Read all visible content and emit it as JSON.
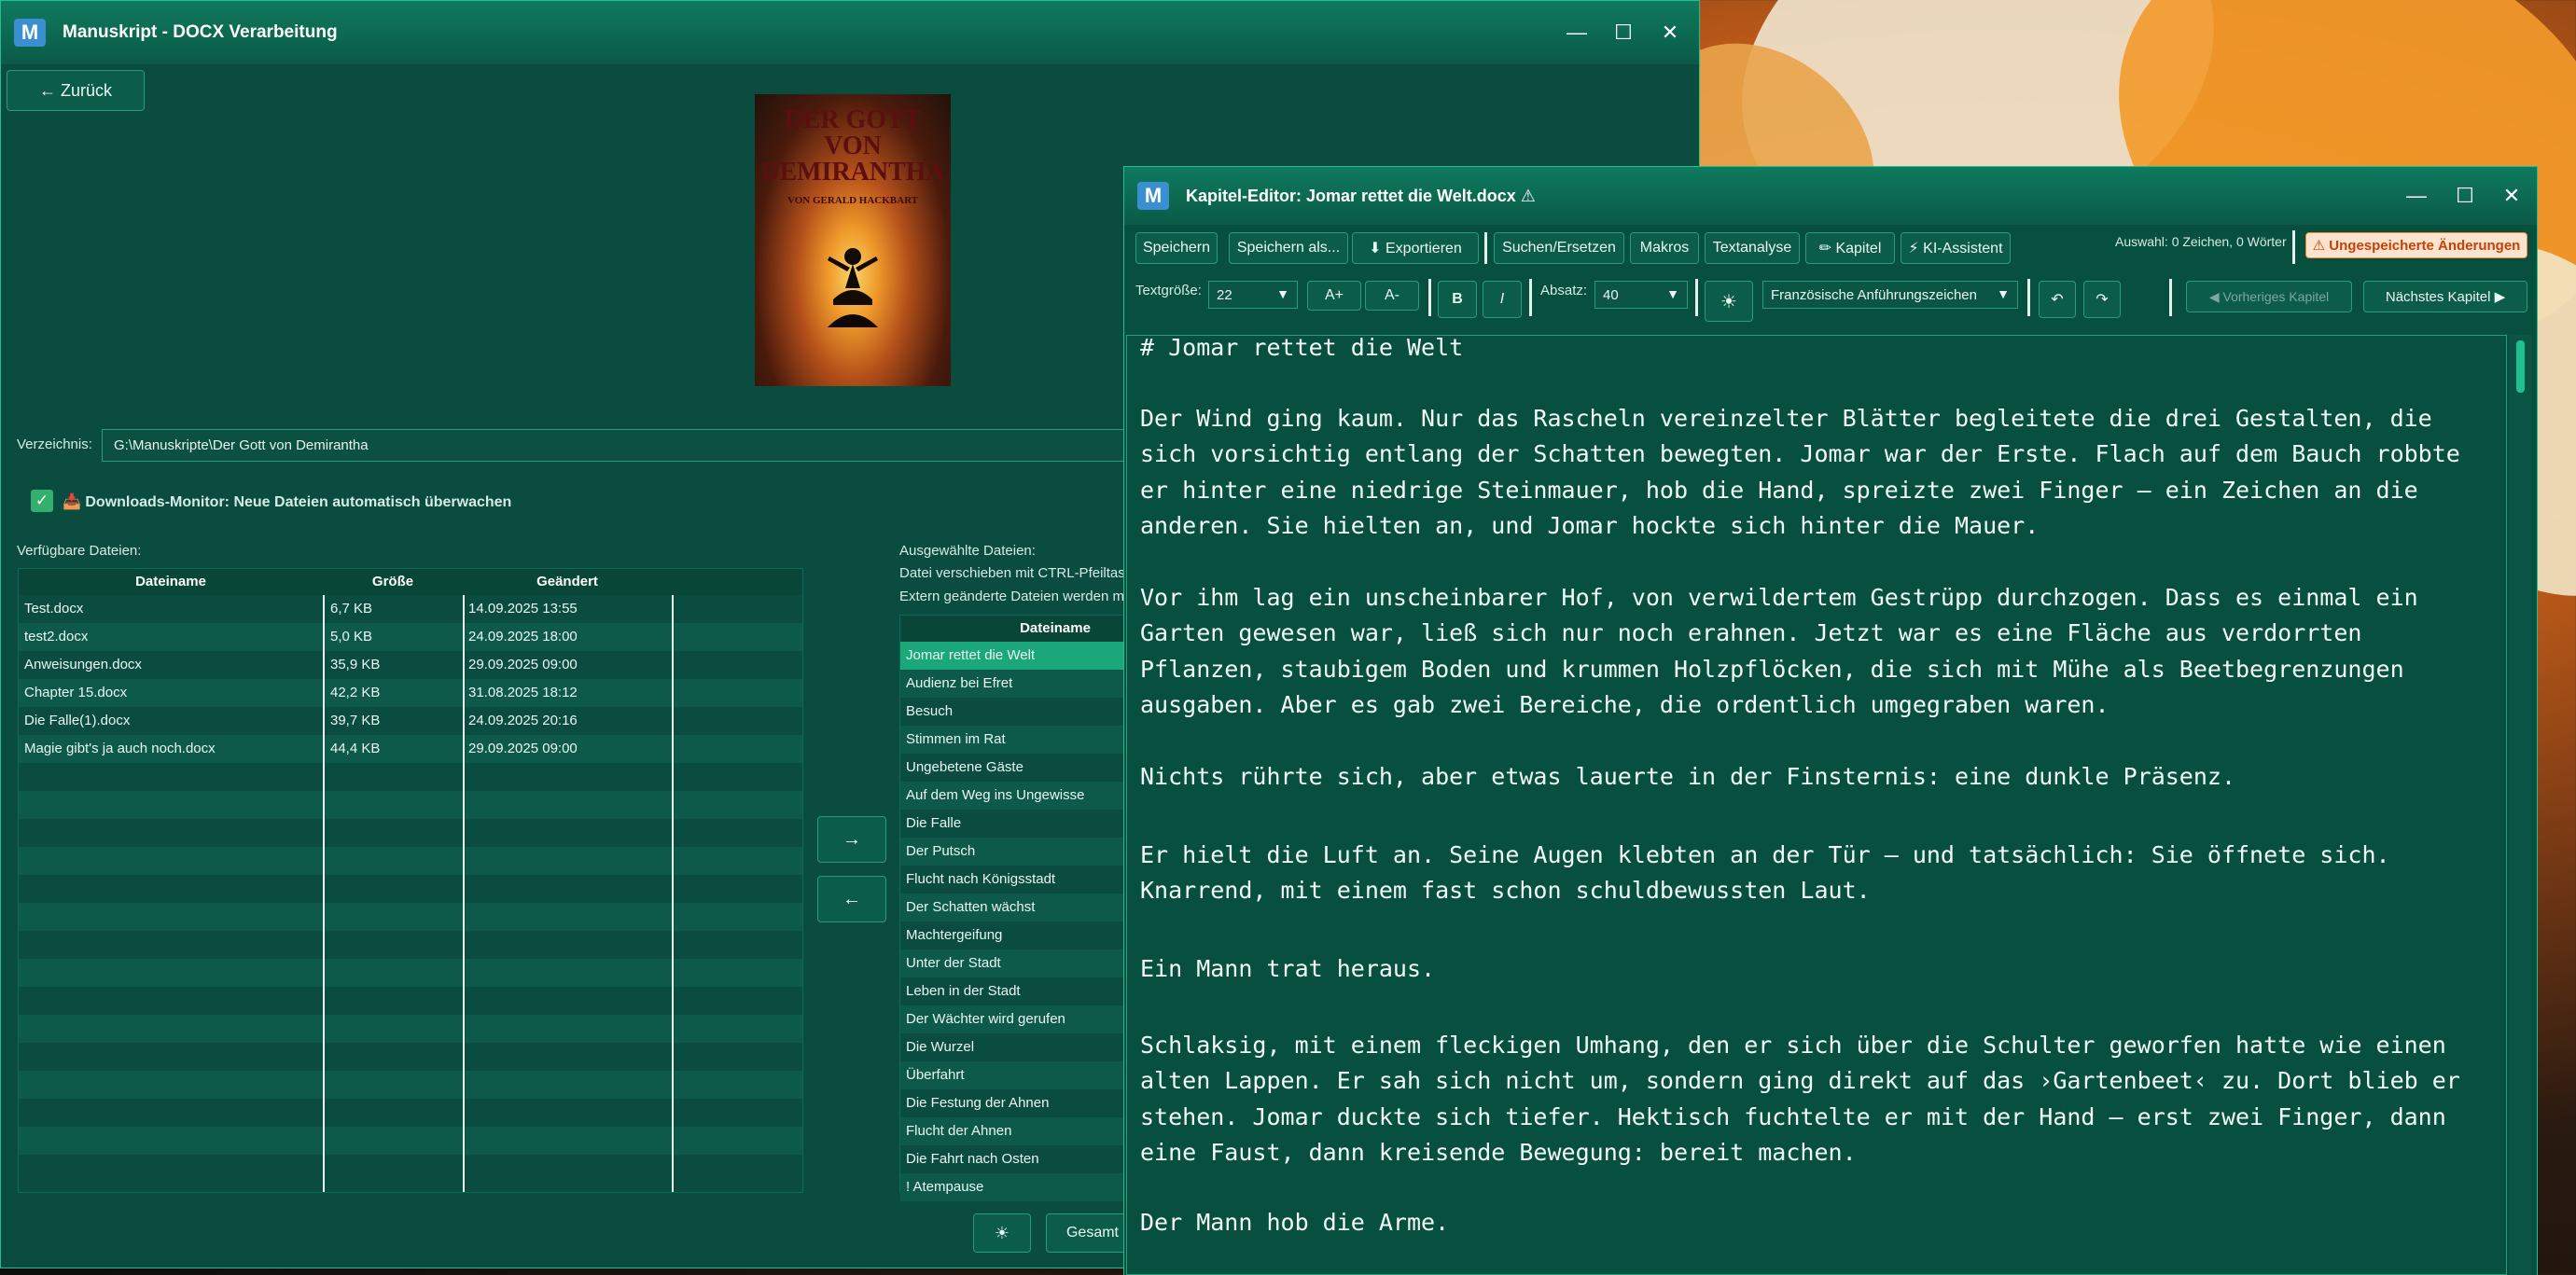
{
  "colors": {
    "accent": "#1aa779",
    "window_bg": "#0a4c3f",
    "warning": "#f58a3c"
  },
  "main_window": {
    "icon_letter": "M",
    "title": "Manuskript - DOCX Verarbeitung",
    "back_button": "← Zurück",
    "book": {
      "title_line1": "DER GOTT",
      "title_line2": "VON",
      "title_line3": "DEMIRANTHA",
      "author": "VON GERALD HACKBART"
    },
    "dir_label": "Verzeichnis:",
    "dir_value": "G:\\Manuskripte\\Der Gott von Demirantha",
    "monitor_label": "📥 Downloads-Monitor: Neue Dateien automatisch überwachen",
    "available_label": "Verfügbare Dateien:",
    "selected_label": "Ausgewählte Dateien:",
    "selected_hint1": "Datei verschieben mit CTRL-Pfeiltaste",
    "selected_hint2": "Extern geänderte Dateien werden m",
    "headers": {
      "name": "Dateiname",
      "size": "Größe",
      "modified": "Geändert"
    },
    "files": [
      {
        "name": "Test.docx",
        "size": "6,7 KB",
        "modified": "14.09.2025 13:55"
      },
      {
        "name": "test2.docx",
        "size": "5,0 KB",
        "modified": "24.09.2025 18:00"
      },
      {
        "name": "Anweisungen.docx",
        "size": "35,9 KB",
        "modified": "29.09.2025 09:00"
      },
      {
        "name": "Chapter 15.docx",
        "size": "42,2 KB",
        "modified": "31.08.2025 18:12"
      },
      {
        "name": "Die Falle(1).docx",
        "size": "39,7 KB",
        "modified": "24.09.2025 20:16"
      },
      {
        "name": "Magie gibt's ja auch noch.docx",
        "size": "44,4 KB",
        "modified": "29.09.2025 09:00"
      }
    ],
    "selected_header": "Dateiname",
    "selected_files": [
      "Jomar rettet die Welt",
      "Audienz bei Efret",
      "Besuch",
      "Stimmen im Rat",
      "Ungebetene Gäste",
      "Auf dem Weg ins Ungewisse",
      "Die Falle",
      "Der Putsch",
      "Flucht nach Königsstadt",
      "Der Schatten wächst",
      "Machtergeifung",
      "Unter der Stadt",
      "Leben in der Stadt",
      "Der Wächter wird gerufen",
      "Die Wurzel",
      "Überfahrt",
      "Die Festung der Ahnen",
      "Flucht der Ahnen",
      "Die Fahrt nach Osten",
      "! Atempause"
    ],
    "move_right": "→",
    "move_left": "←",
    "theme_button": "☀",
    "total_button": "Gesamt"
  },
  "editor_window": {
    "icon_letter": "M",
    "title": "Kapitel-Editor: Jomar rettet die Welt.docx ⚠",
    "toolbar": {
      "save": "Speichern",
      "save_as": "Speichern als...",
      "export": "⬇ Exportieren",
      "find_replace": "Suchen/Ersetzen",
      "macros": "Makros",
      "text_analysis": "Textanalyse",
      "chapter": "✏ Kapitel",
      "ai_assistant": "⚡ KI-Assistent",
      "selection_info": "Auswahl: 0 Zeichen, 0 Wörter",
      "unsaved": "⚠ Ungespeicherte Änderungen"
    },
    "format": {
      "font_size_label": "Textgröße:",
      "font_size": "22",
      "increase": "A+",
      "decrease": "A-",
      "bold": "B",
      "italic": "I",
      "paragraph_label": "Absatz:",
      "paragraph_value": "40",
      "theme": "☀",
      "quotes": "Französische Anführungszeichen",
      "undo": "↶",
      "redo": "↷",
      "prev_chapter": "◀ Vorheriges Kapitel",
      "next_chapter": "Nächstes Kapitel ▶"
    },
    "text": [
      "# Jomar rettet die Welt",
      "Der Wind ging kaum. Nur das Rascheln vereinzelter Blätter begleitete die drei Gestalten, die\nsich vorsichtig entlang der Schatten bewegten. Jomar war der Erste. Flach auf dem Bauch robbte\ner hinter eine niedrige Steinmauer, hob die Hand, spreizte zwei Finger – ein Zeichen an die\nanderen. Sie hielten an, und Jomar hockte sich hinter die Mauer.",
      "Vor ihm lag ein unscheinbarer Hof, von verwildertem Gestrüpp durchzogen. Dass es einmal ein\nGarten gewesen war, ließ sich nur noch erahnen. Jetzt war es eine Fläche aus verdorrten\nPflanzen, staubigem Boden und krummen Holzpflöcken, die sich mit Mühe als Beetbegrenzungen\nausgaben. Aber es gab zwei Bereiche, die ordentlich umgegraben waren.",
      "Nichts rührte sich, aber etwas lauerte in der Finsternis: eine dunkle Präsenz.",
      "Er hielt die Luft an. Seine Augen klebten an der Tür – und tatsächlich: Sie öffnete sich.\nKnarrend, mit einem fast schon schuldbewussten Laut.",
      "Ein Mann trat heraus.",
      "Schlaksig, mit einem fleckigen Umhang, den er sich über die Schulter geworfen hatte wie einen\nalten Lappen. Er sah sich nicht um, sondern ging direkt auf das ›Gartenbeet‹ zu. Dort blieb er\nstehen. Jomar duckte sich tiefer. Hektisch fuchtelte er mit der Hand – erst zwei Finger, dann\neine Faust, dann kreisende Bewegung: bereit machen.",
      "Der Mann hob die Arme."
    ]
  }
}
